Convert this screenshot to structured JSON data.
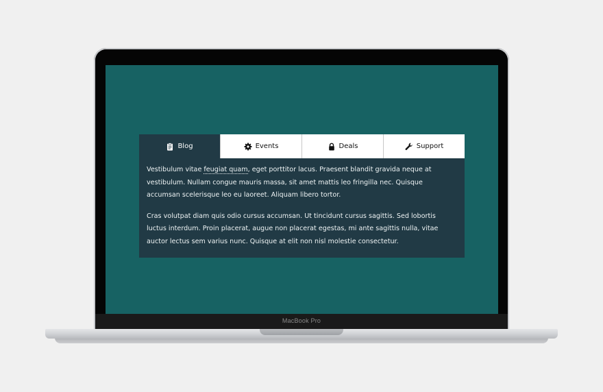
{
  "device": {
    "brand_label": "MacBook Pro"
  },
  "tabs": [
    {
      "label": "Blog",
      "icon": "clipboard-icon",
      "active": true
    },
    {
      "label": "Events",
      "icon": "gear-icon",
      "active": false
    },
    {
      "label": "Deals",
      "icon": "lock-icon",
      "active": false
    },
    {
      "label": "Support",
      "icon": "wrench-icon",
      "active": false
    }
  ],
  "panel": {
    "p1_before": "Vestibulum vitae ",
    "p1_abbr": "feugiat quam",
    "p1_after": ", eget porttitor lacus. Praesent blandit gravida neque at vestibulum. Nullam congue mauris massa, sit amet mattis leo fringilla nec. Quisque accumsan scelerisque leo eu laoreet. Aliquam libero tortor.",
    "p2": "Cras volutpat diam quis odio cursus accumsan. Ut tincidunt cursus sagittis. Sed lobortis luctus interdum. Proin placerat, augue non placerat egestas, mi ante sagittis nulla, vitae auctor lectus sem varius nunc. Quisque at elit non nisl molestie consectetur."
  },
  "colors": {
    "screen_bg": "#176263",
    "panel_bg": "#213a45",
    "tab_bg": "#ffffff",
    "page_bg": "#f0f0f0"
  }
}
